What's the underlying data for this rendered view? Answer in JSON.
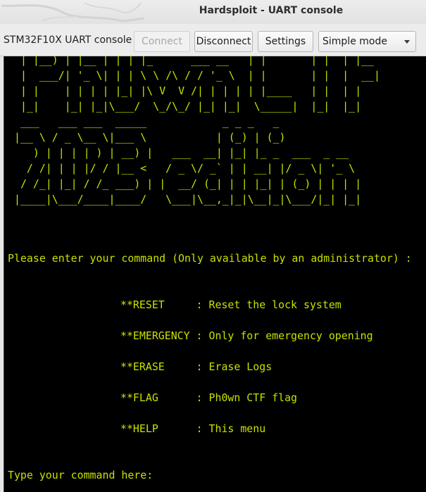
{
  "window": {
    "title": "Hardsploit - UART console"
  },
  "toolbar": {
    "label": "STM32F10X  UART console",
    "connect_label": "Connect",
    "disconnect_label": "Disconnect",
    "settings_label": "Settings",
    "mode_value": "Simple mode"
  },
  "console": {
    "ascii_art": " | |__) | |__ | | | |_      ___ __   | |       | |  | |__\n |  ___/| '_ \\| | | \\ \\ /\\ / / '_ \\  | |       | |  |  __|\n | |    | | | | |_| |\\ V  V /| | | | | |____   | |  | |\n |_|    |_| |_|\\___/  \\_/\\_/ |_| |_|  \\_____|  |_|  |_|\n ___   ___ ___  _____            _ _ _   _\n|__ \\ / _ \\__ \\|___ \\           | (_) | (_)\n   ) | | | | ) | __) |   ___  __| |_| |_ _  ___  _ __\n  / /| | | |/ / |__ <   / _ \\/ _` | | __| |/ _ \\| '_ \\\n / /_| |_| / /_ ___) | |  __/ (_| | | |_| | (_) | | | |\n|____|\\___/____|____/   \\___|\\__,_|_|\\__|_|\\___/|_| |_|",
    "prompt": "Please enter your command (Only available by an administrator) :",
    "commands": [
      "**RESET     : Reset the lock system",
      "**EMERGENCY : Only for emergency opening",
      "**ERASE     : Erase Logs",
      "**FLAG      : Ph0wn CTF flag",
      "**HELP      : This menu"
    ],
    "input_prompt": "Type your command here:"
  },
  "colors": {
    "console_text": "#c8e000",
    "console_background": "#000000"
  }
}
